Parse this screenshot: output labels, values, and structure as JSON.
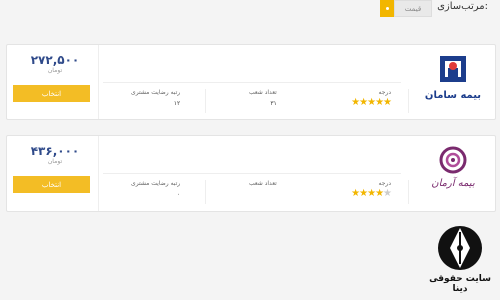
{
  "sort": {
    "title": "مرتب‌سازی:",
    "price_label": "قیمت"
  },
  "offers": [
    {
      "company_logo": "saman-insurance-logo",
      "company_text": "بیمه سامان",
      "price": "۲۷۲,۵۰۰",
      "currency": "تومان",
      "select_label": "انتخاب",
      "rating_label": "درجه",
      "rating_value": 5,
      "branches_label": "تعداد شعب",
      "branches_value": "۳۱",
      "satisfaction_label": "رتبه رضایت مشتری",
      "satisfaction_value": "۱۲"
    },
    {
      "company_logo": "arman-insurance-logo",
      "company_text": "بیمه آرمان",
      "price": "۴۳۶,۰۰۰",
      "currency": "تومان",
      "select_label": "انتخاب",
      "rating_label": "درجه",
      "rating_value": 4,
      "branches_label": "تعداد شعب",
      "branches_value": "",
      "satisfaction_label": "رتبه رضایت مشتری",
      "satisfaction_value": "۰"
    }
  ],
  "watermark": {
    "text": "سایت حقوقی دینا"
  },
  "colors": {
    "accent": "#f3bd25",
    "price": "#2f4a8a",
    "saman_blue": "#1c3d8c",
    "arman_purple": "#7a2a6e"
  }
}
